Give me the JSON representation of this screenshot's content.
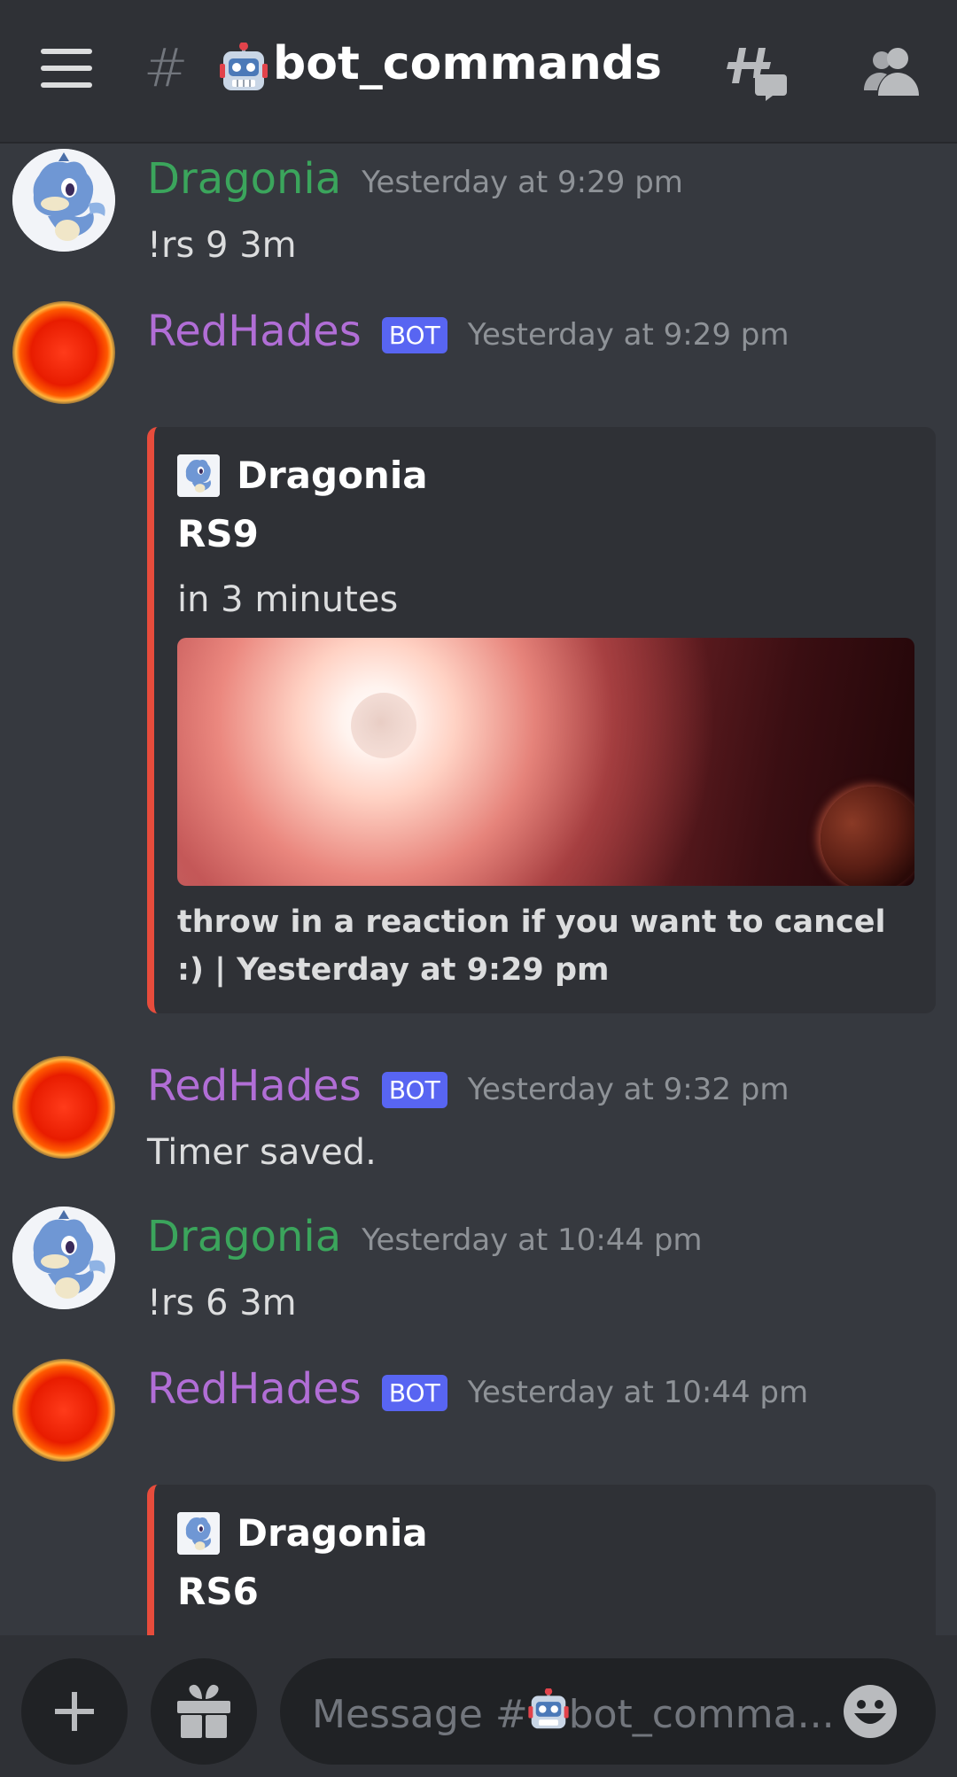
{
  "header": {
    "channel_hash": "#",
    "channel_name": "bot_commands",
    "icons": [
      "menu-icon",
      "robot-emoji-icon",
      "threads-icon",
      "members-icon"
    ]
  },
  "messages": [
    {
      "author": "Dragonia",
      "timestamp": "Yesterday at 9:29 pm",
      "content": "!rs 9 3m",
      "avatar": "dragon-avatar"
    },
    {
      "author": "RedHades",
      "badge": "BOT",
      "timestamp": "Yesterday at 9:29 pm",
      "avatar": "sun-avatar",
      "embed": {
        "author": "Dragonia",
        "title": "RS9",
        "description": "in 3 minutes",
        "footer": "throw in a reaction if you want to cancel :) | Yesterday at 9:29 pm",
        "color": "#e74c3c"
      }
    },
    {
      "author": "RedHades",
      "badge": "BOT",
      "timestamp": "Yesterday at 9:32 pm",
      "content": "Timer saved.",
      "avatar": "sun-avatar"
    },
    {
      "author": "Dragonia",
      "timestamp": "Yesterday at 10:44 pm",
      "content": "!rs 6 3m",
      "avatar": "dragon-avatar"
    },
    {
      "author": "RedHades",
      "badge": "BOT",
      "timestamp": "Yesterday at 10:44 pm",
      "avatar": "sun-avatar",
      "embed": {
        "author": "Dragonia",
        "title": "RS6",
        "color": "#e74c3c"
      }
    }
  ],
  "composer": {
    "placeholder_prefix": "Message #",
    "placeholder_suffix": "bot_comma..."
  },
  "colors": {
    "background": "#36393f",
    "header": "#2f3136",
    "user_green": "#3ba55c",
    "bot_purple": "#b16ed6",
    "bot_badge": "#5865f2",
    "embed_accent": "#e74c3c"
  }
}
